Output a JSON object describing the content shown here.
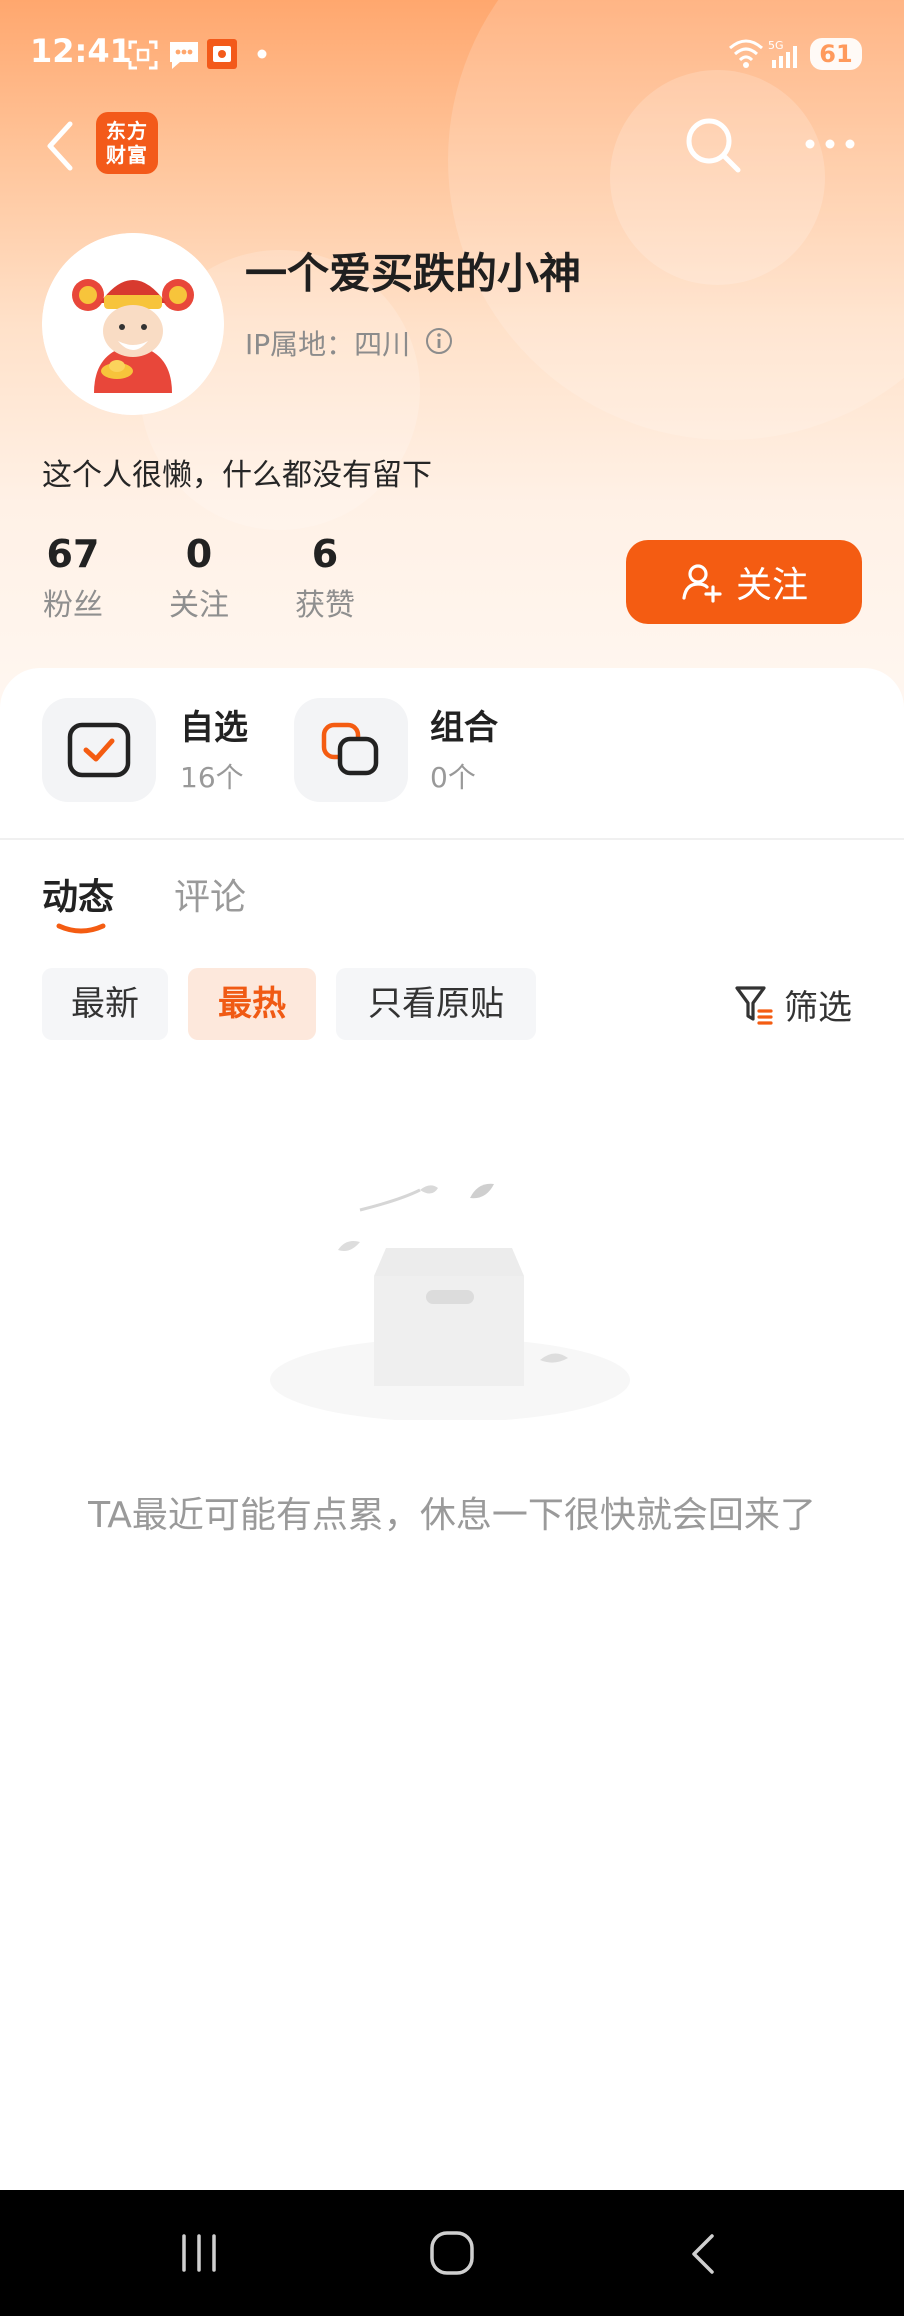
{
  "status_bar": {
    "time": "12:41",
    "battery": "61",
    "network": "5G"
  },
  "header": {
    "app_logo_lines": [
      "东方",
      "财富"
    ],
    "back_icon": "chevron-left-icon",
    "search_icon": "search-icon",
    "more_icon": "more-dots-icon"
  },
  "profile": {
    "username": "一个爱买跌的小神",
    "ip_location": "IP属地：四川",
    "bio": "这个人很懒，什么都没有留下",
    "stats": [
      {
        "value": "67",
        "label": "粉丝"
      },
      {
        "value": "0",
        "label": "关注"
      },
      {
        "value": "6",
        "label": "获赞"
      }
    ],
    "follow_button": "关注"
  },
  "assets": [
    {
      "title": "自选",
      "count": "16个",
      "icon": "checklist-icon"
    },
    {
      "title": "组合",
      "count": "0个",
      "icon": "portfolio-icon"
    }
  ],
  "tabs": [
    {
      "label": "动态",
      "active": true
    },
    {
      "label": "评论",
      "active": false
    }
  ],
  "chips": [
    {
      "label": "最新",
      "active": false
    },
    {
      "label": "最热",
      "active": true
    },
    {
      "label": "只看原贴",
      "active": false
    }
  ],
  "filter_label": "筛选",
  "empty_state": "TA最近可能有点累，休息一下很快就会回来了",
  "colors": {
    "accent": "#f45c12",
    "hero_top": "#ffa76e",
    "hero_bottom": "#fff7f1"
  }
}
